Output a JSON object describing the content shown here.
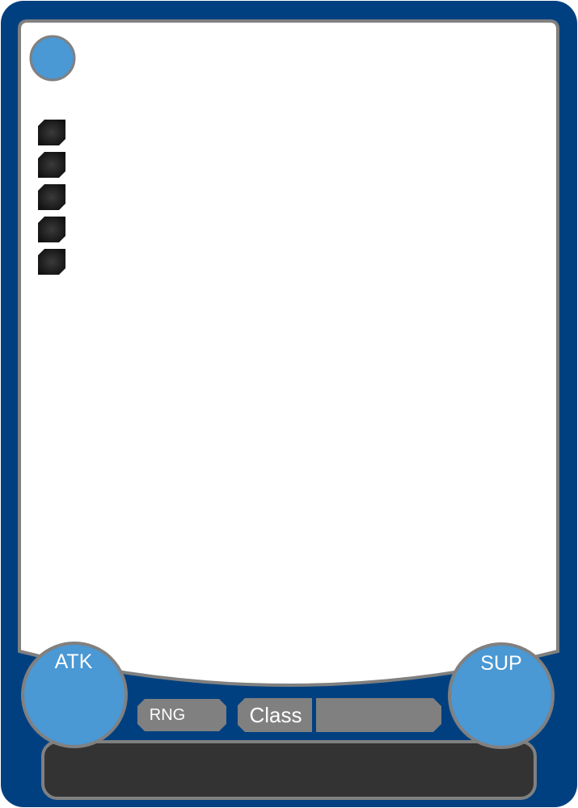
{
  "card": {
    "colors": {
      "frame": "#004080",
      "art_panel": "#ffffff",
      "panel_border": "#808080",
      "stat_circle": "#4a98d4",
      "pill": "#808080",
      "text_box": "#333333",
      "pip": "#1a1a1a"
    },
    "cost_gem": {
      "icon": "circle-gem-icon",
      "value": ""
    },
    "pips": {
      "count": 5,
      "icon": "octagon-pip-icon"
    },
    "stats": {
      "attack_label": "ATK",
      "attack_value": "",
      "support_label": "SUP",
      "support_value": ""
    },
    "fields": {
      "range_label": "RNG",
      "range_value": "",
      "class_label": "Class",
      "class_value": ""
    },
    "text_box": {
      "value": ""
    }
  }
}
